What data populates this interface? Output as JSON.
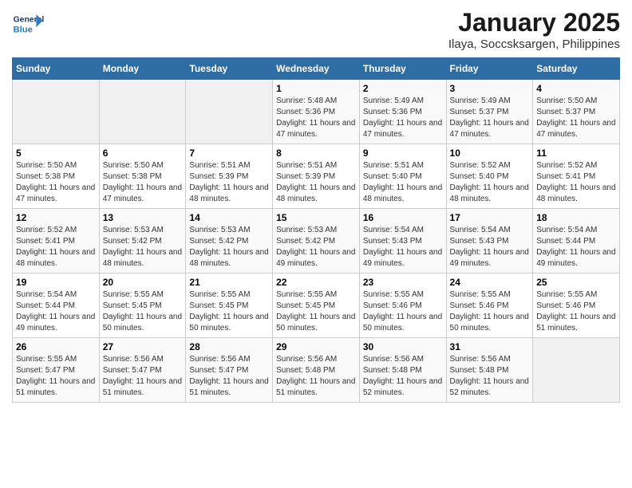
{
  "header": {
    "logo_general": "General",
    "logo_blue": "Blue",
    "title": "January 2025",
    "subtitle": "Ilaya, Soccsksargen, Philippines"
  },
  "days_of_week": [
    "Sunday",
    "Monday",
    "Tuesday",
    "Wednesday",
    "Thursday",
    "Friday",
    "Saturday"
  ],
  "weeks": [
    {
      "days": [
        {
          "num": "",
          "empty": true
        },
        {
          "num": "",
          "empty": true
        },
        {
          "num": "",
          "empty": true
        },
        {
          "num": "1",
          "sunrise": "5:48 AM",
          "sunset": "5:36 PM",
          "daylight": "11 hours and 47 minutes."
        },
        {
          "num": "2",
          "sunrise": "5:49 AM",
          "sunset": "5:36 PM",
          "daylight": "11 hours and 47 minutes."
        },
        {
          "num": "3",
          "sunrise": "5:49 AM",
          "sunset": "5:37 PM",
          "daylight": "11 hours and 47 minutes."
        },
        {
          "num": "4",
          "sunrise": "5:50 AM",
          "sunset": "5:37 PM",
          "daylight": "11 hours and 47 minutes."
        }
      ]
    },
    {
      "days": [
        {
          "num": "5",
          "sunrise": "5:50 AM",
          "sunset": "5:38 PM",
          "daylight": "11 hours and 47 minutes."
        },
        {
          "num": "6",
          "sunrise": "5:50 AM",
          "sunset": "5:38 PM",
          "daylight": "11 hours and 47 minutes."
        },
        {
          "num": "7",
          "sunrise": "5:51 AM",
          "sunset": "5:39 PM",
          "daylight": "11 hours and 48 minutes."
        },
        {
          "num": "8",
          "sunrise": "5:51 AM",
          "sunset": "5:39 PM",
          "daylight": "11 hours and 48 minutes."
        },
        {
          "num": "9",
          "sunrise": "5:51 AM",
          "sunset": "5:40 PM",
          "daylight": "11 hours and 48 minutes."
        },
        {
          "num": "10",
          "sunrise": "5:52 AM",
          "sunset": "5:40 PM",
          "daylight": "11 hours and 48 minutes."
        },
        {
          "num": "11",
          "sunrise": "5:52 AM",
          "sunset": "5:41 PM",
          "daylight": "11 hours and 48 minutes."
        }
      ]
    },
    {
      "days": [
        {
          "num": "12",
          "sunrise": "5:52 AM",
          "sunset": "5:41 PM",
          "daylight": "11 hours and 48 minutes."
        },
        {
          "num": "13",
          "sunrise": "5:53 AM",
          "sunset": "5:42 PM",
          "daylight": "11 hours and 48 minutes."
        },
        {
          "num": "14",
          "sunrise": "5:53 AM",
          "sunset": "5:42 PM",
          "daylight": "11 hours and 48 minutes."
        },
        {
          "num": "15",
          "sunrise": "5:53 AM",
          "sunset": "5:42 PM",
          "daylight": "11 hours and 49 minutes."
        },
        {
          "num": "16",
          "sunrise": "5:54 AM",
          "sunset": "5:43 PM",
          "daylight": "11 hours and 49 minutes."
        },
        {
          "num": "17",
          "sunrise": "5:54 AM",
          "sunset": "5:43 PM",
          "daylight": "11 hours and 49 minutes."
        },
        {
          "num": "18",
          "sunrise": "5:54 AM",
          "sunset": "5:44 PM",
          "daylight": "11 hours and 49 minutes."
        }
      ]
    },
    {
      "days": [
        {
          "num": "19",
          "sunrise": "5:54 AM",
          "sunset": "5:44 PM",
          "daylight": "11 hours and 49 minutes."
        },
        {
          "num": "20",
          "sunrise": "5:55 AM",
          "sunset": "5:45 PM",
          "daylight": "11 hours and 50 minutes."
        },
        {
          "num": "21",
          "sunrise": "5:55 AM",
          "sunset": "5:45 PM",
          "daylight": "11 hours and 50 minutes."
        },
        {
          "num": "22",
          "sunrise": "5:55 AM",
          "sunset": "5:45 PM",
          "daylight": "11 hours and 50 minutes."
        },
        {
          "num": "23",
          "sunrise": "5:55 AM",
          "sunset": "5:46 PM",
          "daylight": "11 hours and 50 minutes."
        },
        {
          "num": "24",
          "sunrise": "5:55 AM",
          "sunset": "5:46 PM",
          "daylight": "11 hours and 50 minutes."
        },
        {
          "num": "25",
          "sunrise": "5:55 AM",
          "sunset": "5:46 PM",
          "daylight": "11 hours and 51 minutes."
        }
      ]
    },
    {
      "days": [
        {
          "num": "26",
          "sunrise": "5:55 AM",
          "sunset": "5:47 PM",
          "daylight": "11 hours and 51 minutes."
        },
        {
          "num": "27",
          "sunrise": "5:56 AM",
          "sunset": "5:47 PM",
          "daylight": "11 hours and 51 minutes."
        },
        {
          "num": "28",
          "sunrise": "5:56 AM",
          "sunset": "5:47 PM",
          "daylight": "11 hours and 51 minutes."
        },
        {
          "num": "29",
          "sunrise": "5:56 AM",
          "sunset": "5:48 PM",
          "daylight": "11 hours and 51 minutes."
        },
        {
          "num": "30",
          "sunrise": "5:56 AM",
          "sunset": "5:48 PM",
          "daylight": "11 hours and 52 minutes."
        },
        {
          "num": "31",
          "sunrise": "5:56 AM",
          "sunset": "5:48 PM",
          "daylight": "11 hours and 52 minutes."
        },
        {
          "num": "",
          "empty": true
        }
      ]
    }
  ],
  "labels": {
    "sunrise": "Sunrise:",
    "sunset": "Sunset:",
    "daylight": "Daylight:"
  }
}
